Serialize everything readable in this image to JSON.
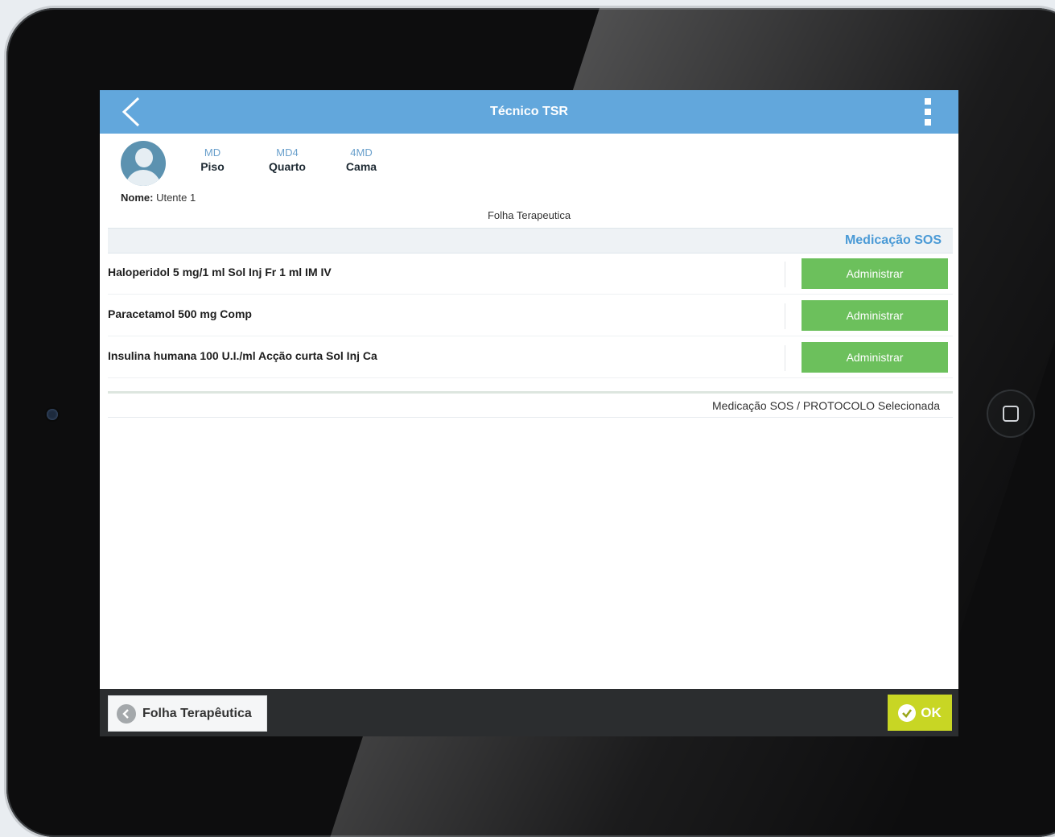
{
  "header": {
    "title": "Técnico TSR"
  },
  "patient": {
    "piso": {
      "code": "MD",
      "label": "Piso"
    },
    "quarto": {
      "code": "MD4",
      "label": "Quarto"
    },
    "cama": {
      "code": "4MD",
      "label": "Cama"
    },
    "nome_label": "Nome:",
    "nome_value": "Utente 1"
  },
  "sheet_title": "Folha Terapeutica",
  "sos_section": {
    "title": "Medicação SOS",
    "medications": [
      {
        "name": "Haloperidol 5 mg/1 ml Sol Inj Fr 1 ml IM IV",
        "action": "Administrar"
      },
      {
        "name": "Paracetamol 500 mg Comp",
        "action": "Administrar"
      },
      {
        "name": "Insulina humana 100 U.I./ml Acção curta Sol Inj Ca",
        "action": "Administrar"
      }
    ],
    "selected_note": "Medicação SOS / PROTOCOLO Selecionada"
  },
  "footer": {
    "back_label": "Folha Terapêutica",
    "ok_label": "OK"
  },
  "colors": {
    "topbar": "#62a7dc",
    "accent": "#4a9ad6",
    "administrar": "#6cc05c",
    "ok": "#c8d624"
  }
}
